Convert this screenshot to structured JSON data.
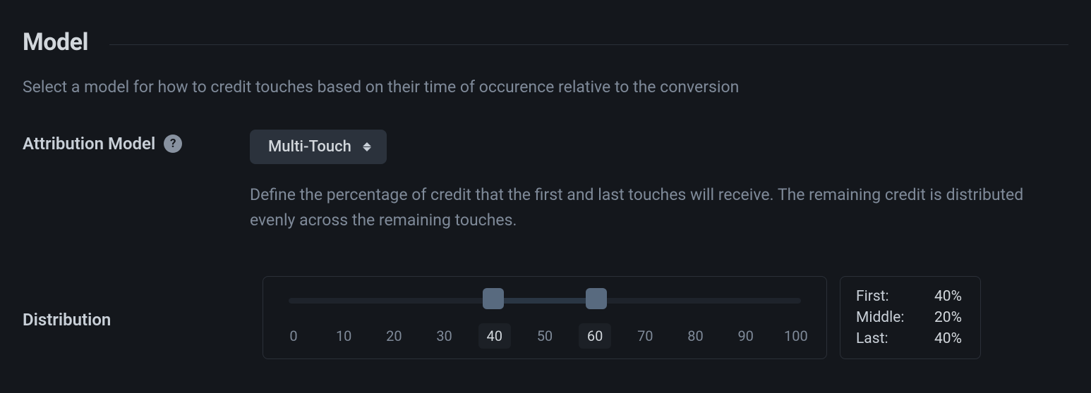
{
  "section": {
    "title": "Model",
    "description": "Select a model for how to credit touches based on their time of occurence relative to the conversion"
  },
  "attribution": {
    "label": "Attribution Model",
    "selected": "Multi-Touch",
    "helper": "Define the percentage of credit that the first and last touches will receive. The remaining credit is distributed evenly across the remaining touches."
  },
  "distribution": {
    "label": "Distribution",
    "min": 0,
    "max": 100,
    "handle_a": 40,
    "handle_b": 60,
    "ticks": [
      0,
      10,
      20,
      30,
      40,
      50,
      60,
      70,
      80,
      90,
      100
    ],
    "summary": {
      "first_label": "First:",
      "first_value": "40%",
      "middle_label": "Middle:",
      "middle_value": "20%",
      "last_label": "Last:",
      "last_value": "40%"
    }
  }
}
